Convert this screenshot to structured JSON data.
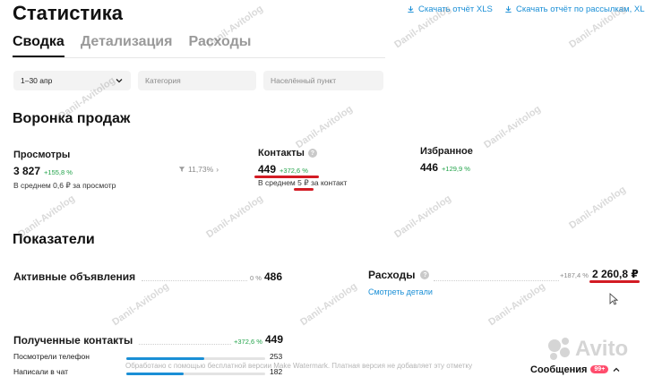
{
  "header": {
    "title": "Статистика",
    "download_xls": "Скачать отчёт XLS",
    "download_mailings_xls": "Скачать отчёт по рассылкам, XLS"
  },
  "tabs": [
    {
      "label": "Сводка",
      "active": true
    },
    {
      "label": "Детализация",
      "active": false
    },
    {
      "label": "Расходы",
      "active": false
    }
  ],
  "filters": {
    "period_value": "1–30 апр",
    "category_placeholder": "Категория",
    "city_placeholder": "Населённый пункт"
  },
  "funnel": {
    "title": "Воронка продаж",
    "views": {
      "label": "Просмотры",
      "value": "3 827",
      "delta": "+155,8 %",
      "sub": "В среднем 0,6 ₽ за просмотр"
    },
    "conversion": "11,73%",
    "contacts": {
      "label": "Контакты",
      "value": "449",
      "delta": "+372,6 %",
      "sub": "В среднем 5 ₽ за контакт"
    },
    "favorites": {
      "label": "Избранное",
      "value": "446",
      "delta": "+129,9 %"
    }
  },
  "metrics": {
    "title": "Показатели",
    "active_ads": {
      "label": "Активные объявления",
      "pct": "0 %",
      "value": "486"
    },
    "expenses": {
      "label": "Расходы",
      "pct": "+187,4 %",
      "value": "2 260,8 ₽",
      "link": "Смотреть детали"
    },
    "received_contacts": {
      "label": "Полученные контакты",
      "pct": "+372,6 %",
      "value": "449",
      "rows": [
        {
          "label": "Посмотрели телефон",
          "value": "253",
          "fill": 0.56
        },
        {
          "label": "Написали в чат",
          "value": "182",
          "fill": 0.41
        }
      ]
    }
  },
  "overlay": {
    "watermark": "Danil-Avitolog",
    "bottom_strip": "Обработано с помощью бесплатной версии Make Watermark. Платная версия не добавляет эту отметку",
    "messages_label": "Сообщения",
    "messages_badge": "99+",
    "logo_text": "Avito"
  },
  "colors": {
    "accent": "#1a8fd6",
    "positive": "#22a34a",
    "highlight": "#d31b24"
  }
}
